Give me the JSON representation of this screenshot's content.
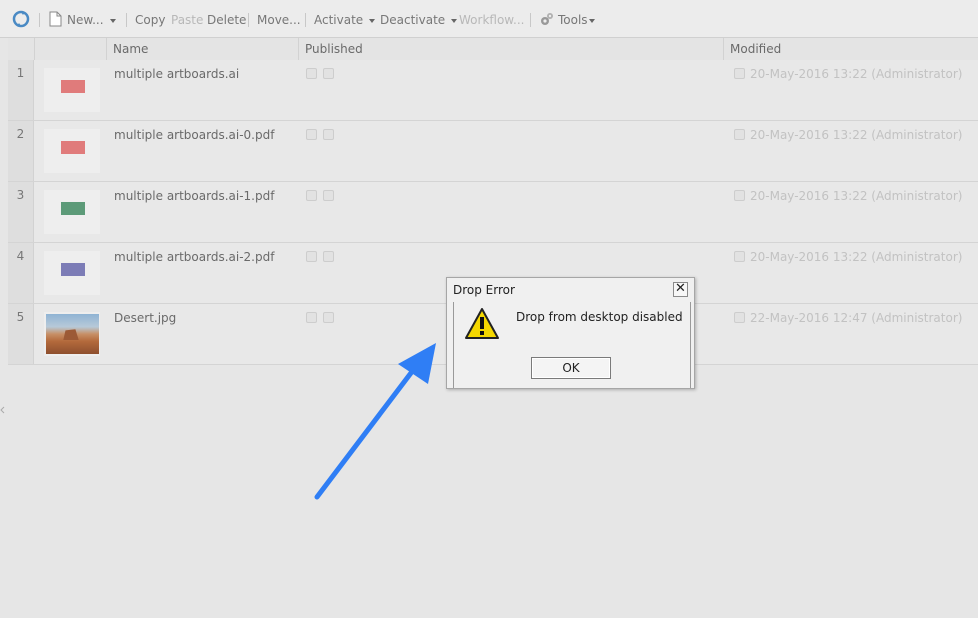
{
  "toolbar": {
    "new_label": "New...",
    "copy_label": "Copy",
    "paste_label": "Paste",
    "delete_label": "Delete",
    "move_label": "Move...",
    "activate_label": "Activate",
    "deactivate_label": "Deactivate",
    "workflow_label": "Workflow...",
    "tools_label": "Tools"
  },
  "grid": {
    "columns": {
      "name": "Name",
      "published": "Published",
      "modified": "Modified"
    },
    "rows": [
      {
        "num": "1",
        "name": "multiple artboards.ai",
        "modified": "20-May-2016 13:22 (Administrator)",
        "swatch": "#e07b7b"
      },
      {
        "num": "2",
        "name": "multiple artboards.ai-0.pdf",
        "modified": "20-May-2016 13:22 (Administrator)",
        "swatch": "#e07b7b"
      },
      {
        "num": "3",
        "name": "multiple artboards.ai-1.pdf",
        "modified": "20-May-2016 13:22 (Administrator)",
        "swatch": "#5c9a78"
      },
      {
        "num": "4",
        "name": "multiple artboards.ai-2.pdf",
        "modified": "20-May-2016 13:22 (Administrator)",
        "swatch": "#7c7cb6"
      },
      {
        "num": "5",
        "name": "Desert.jpg",
        "modified": "22-May-2016 12:47 (Administrator)",
        "swatch": "photo"
      }
    ]
  },
  "dialog": {
    "title": "Drop Error",
    "message": "Drop from desktop disabled",
    "ok_label": "OK",
    "close_glyph": "✕"
  },
  "colors": {
    "arrow": "#2f7ef5",
    "warning_fill": "#f5d800"
  }
}
